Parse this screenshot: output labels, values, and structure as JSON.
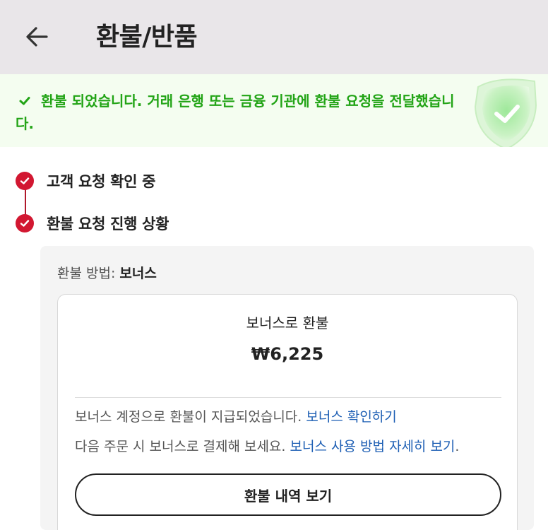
{
  "header": {
    "title": "환불/반품"
  },
  "banner": {
    "message": "환불 되었습니다. 거래 은행 또는 금융 기관에 환불 요청을 전달했습니다.",
    "accent_color": "#22a416"
  },
  "timeline": {
    "steps": [
      {
        "label": "고객 요청 확인 중",
        "status": "done"
      },
      {
        "label": "환불 요청 진행 상황",
        "status": "done"
      }
    ],
    "accent_color": "#d21731"
  },
  "refund": {
    "method_label": "환불 방법: ",
    "method_value": "보너스",
    "card_title": "보너스로 환불",
    "amount": "₩6,225",
    "info1_text": "보너스 계정으로 환불이 지급되었습니다. ",
    "info1_link": "보너스 확인하기",
    "info2_text": "다음 주문 시 보너스로 결제해 보세요.  ",
    "info2_link": "보너스 사용 방법 자세히 보기",
    "info2_suffix": ".",
    "history_button": "환불 내역 보기"
  }
}
